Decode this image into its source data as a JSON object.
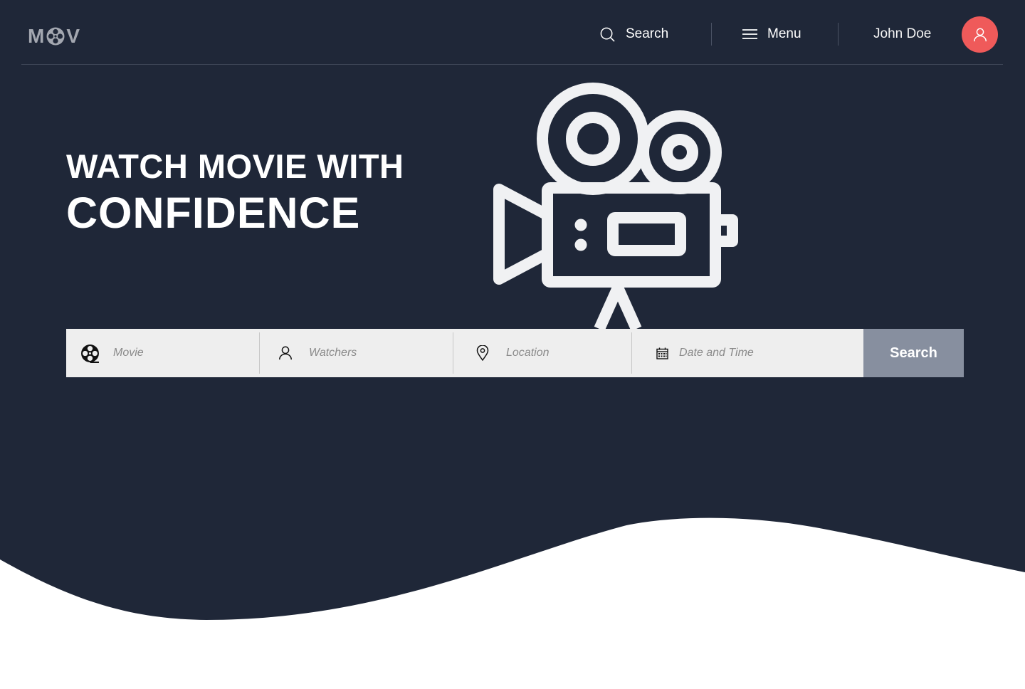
{
  "brand": {
    "logo_left": "M",
    "logo_right": "V",
    "logo_reel_icon": "film-reel-icon"
  },
  "nav": {
    "search_label": "Search",
    "menu_label": "Menu",
    "user_name": "John Doe",
    "avatar_icon": "user-icon",
    "avatar_color": "#ef5a5a"
  },
  "hero": {
    "line1": "WATCH MOVIE WITH",
    "line2": "CONFIDENCE",
    "illustration_icon": "movie-camera-icon"
  },
  "search_form": {
    "fields": [
      {
        "icon": "film-reel-icon",
        "placeholder": "Movie"
      },
      {
        "icon": "user-icon",
        "placeholder": "Watchers"
      },
      {
        "icon": "location-pin-icon",
        "placeholder": "Location"
      },
      {
        "icon": "calendar-icon",
        "placeholder": "Date and Time"
      }
    ],
    "submit_label": "Search"
  },
  "colors": {
    "background": "#1f2738",
    "accent": "#ef5a5a",
    "search_button": "#878f9f",
    "search_bar": "#eeeeee"
  }
}
